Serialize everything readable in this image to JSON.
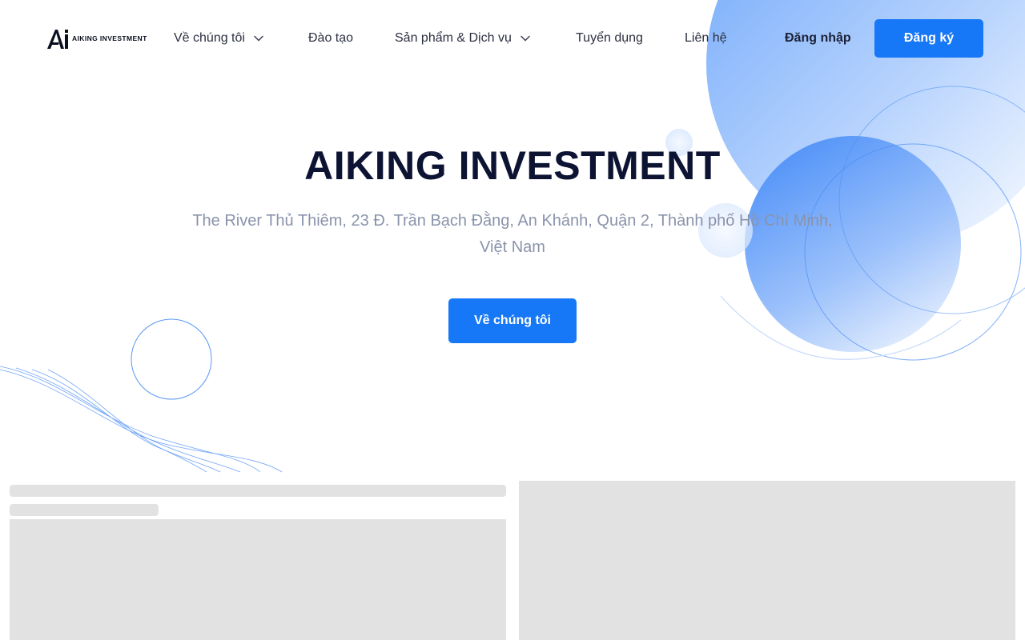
{
  "header": {
    "logo_text": "AIKING INVESTMENT",
    "nav": [
      {
        "label": "Về chúng tôi",
        "has_dropdown": true
      },
      {
        "label": "Đào tạo",
        "has_dropdown": false
      },
      {
        "label": "Sản phẩm & Dịch vụ",
        "has_dropdown": true
      },
      {
        "label": "Tuyển dụng",
        "has_dropdown": false
      },
      {
        "label": "Liên hệ",
        "has_dropdown": false
      }
    ],
    "login_label": "Đăng nhập",
    "register_label": "Đăng ký"
  },
  "hero": {
    "title": "AIKING INVESTMENT",
    "address": "The River Thủ Thiêm, 23 Đ. Trần Bạch Đằng, An Khánh, Quận 2, Thành phố Hồ Chí Minh, Việt Nam",
    "cta_label": "Về chúng tôi"
  },
  "icons": {
    "dropdown": "chevron-down-icon",
    "logo": "aiking-logo-icon"
  },
  "colors": {
    "primary": "#1677f7",
    "title": "#0d1433",
    "muted_text": "#8a93ab",
    "nav_text": "#2b3040",
    "skeleton": "#e2e2e2"
  }
}
